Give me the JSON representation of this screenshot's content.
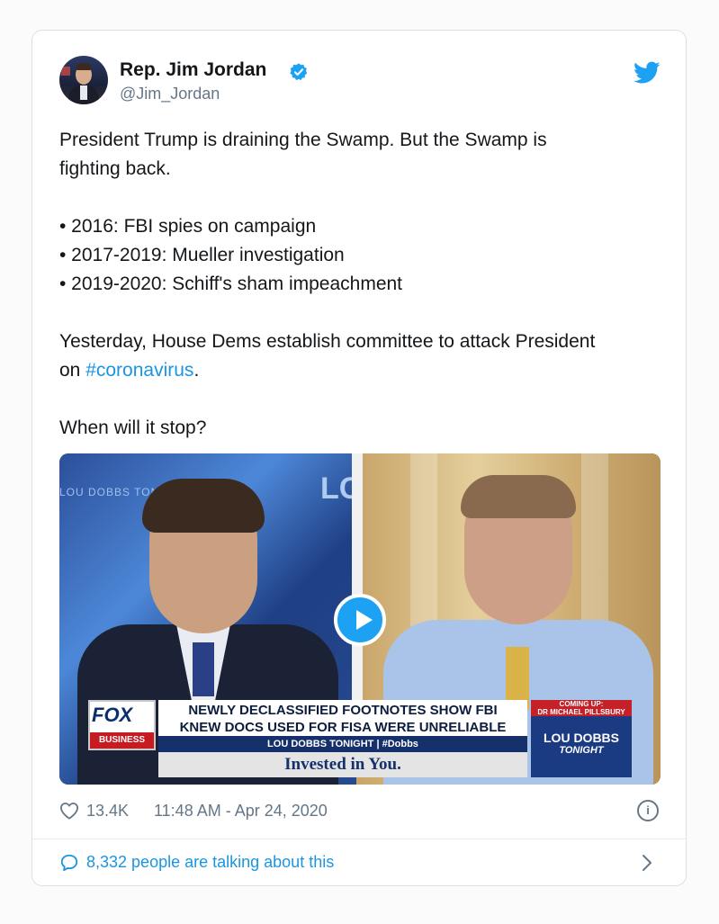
{
  "tweet": {
    "author_name": "Rep. Jim Jordan",
    "handle": "@Jim_Jordan",
    "line1": "President Trump is draining the Swamp. But the Swamp is",
    "line2": "fighting back.",
    "bullets": [
      "• 2016: FBI spies on campaign",
      "• 2017-2019: Mueller investigation",
      "• 2019-2020: Schiff's sham impeachment"
    ],
    "line3_pre": "Yesterday, House Dems establish committee to attack President",
    "line4_pre": "on ",
    "hashtag": "#coronavirus",
    "line4_post": ".",
    "line5": "When will it stop?",
    "likes": "13.4K",
    "timestamp": "11:48 AM - Apr 24, 2020",
    "talking": "8,332 people are talking about this"
  },
  "video": {
    "watermark": "LOU DOBBS TONIGHT",
    "lc_text": "LC",
    "fox": "FOX",
    "business": "BUSINESS",
    "headline_1": "NEWLY DECLASSIFIED FOOTNOTES SHOW FBI",
    "headline_2": "KNEW DOCS USED FOR FISA WERE UNRELIABLE",
    "subbar": "LOU DOBBS TONIGHT | #Dobbs",
    "tagline": "Invested in You.",
    "coming_1": "COMING UP:",
    "coming_2": "DR MICHAEL PILLSBURY",
    "ldt_1": "LOU DOBBS",
    "ldt_2": "TONIGHT"
  },
  "colors": {
    "accent": "#1b95e0",
    "verified": "#1da1f2",
    "secondary_text": "#657786"
  },
  "icons": [
    "verified-badge-icon",
    "twitter-bird-icon",
    "play-icon",
    "heart-icon",
    "info-icon",
    "comment-icon",
    "chevron-right-icon"
  ]
}
